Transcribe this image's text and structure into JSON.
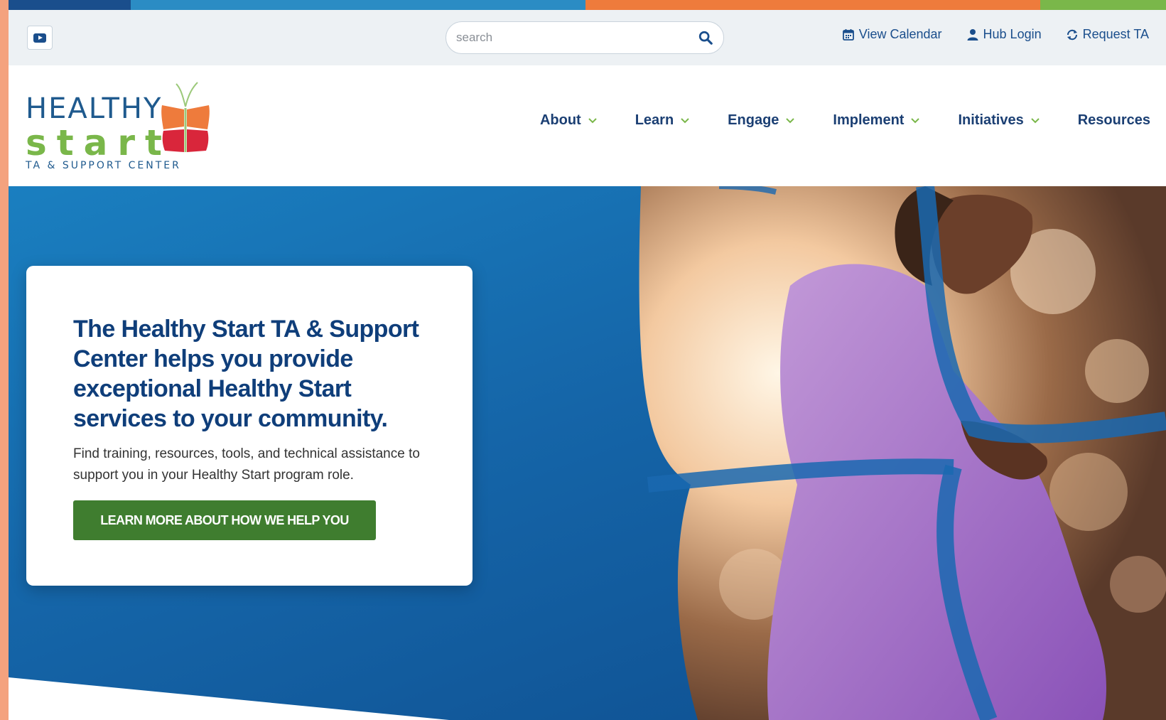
{
  "brand": {
    "colors": {
      "stripe_1": "#1a4e8c",
      "stripe_2": "#2b8cc4",
      "stripe_3": "#ee7b3c",
      "stripe_4": "#7ab74a",
      "nav_text": "#1b3f73",
      "link_blue": "#1a4e8c",
      "cta_green": "#3f7d2f",
      "hero_blue": "#1565a8",
      "logo_green": "#7ab74a",
      "logo_orange": "#ee7b3c",
      "logo_red": "#d9263b"
    }
  },
  "utility": {
    "youtube_icon": "youtube-icon",
    "search_placeholder": "search",
    "links": [
      {
        "label": "View Calendar",
        "icon": "calendar-icon"
      },
      {
        "label": "Hub Login",
        "icon": "user-icon"
      },
      {
        "label": "Request TA",
        "icon": "refresh-icon"
      }
    ]
  },
  "logo": {
    "line1": "HEALTHY",
    "line2": "start",
    "line3": "TA & SUPPORT CENTER"
  },
  "nav": {
    "items": [
      {
        "label": "About",
        "has_dropdown": true
      },
      {
        "label": "Learn",
        "has_dropdown": true
      },
      {
        "label": "Engage",
        "has_dropdown": true
      },
      {
        "label": "Implement",
        "has_dropdown": true
      },
      {
        "label": "Initiatives",
        "has_dropdown": true
      },
      {
        "label": "Resources",
        "has_dropdown": false
      }
    ]
  },
  "hero": {
    "title": "The Healthy Start TA & Support Center helps you provide exceptional Healthy Start services to your community.",
    "text": "Find training, resources, tools, and technical assistance to support you in your Healthy Start program role.",
    "cta_label": "LEARN MORE ABOUT HOW WE HELP YOU"
  }
}
